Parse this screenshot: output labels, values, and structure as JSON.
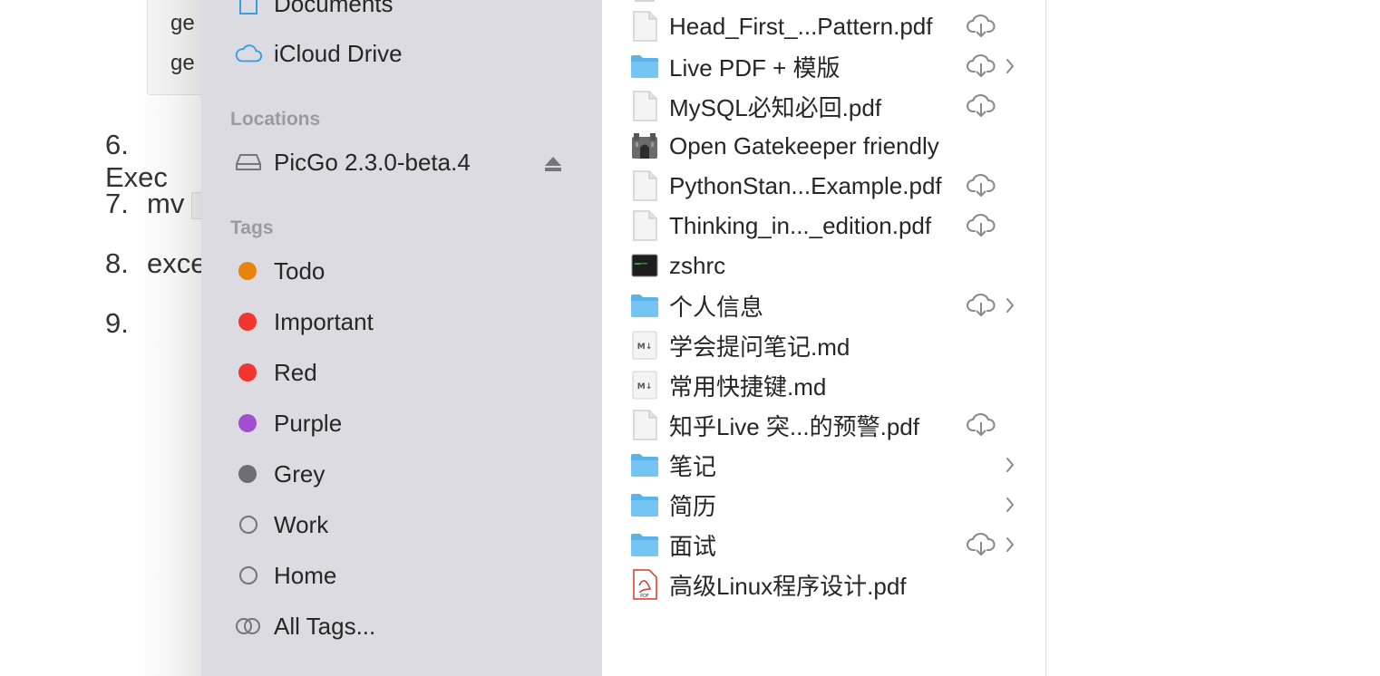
{
  "document": {
    "code_lines": [
      "ge",
      "ge"
    ],
    "list_items": [
      {
        "num": "6.",
        "text": "Exec"
      },
      {
        "num": "7.",
        "text": "mv"
      },
      {
        "num": "8.",
        "text": "exce"
      },
      {
        "num": "9.",
        "text": ""
      }
    ]
  },
  "sidebar": {
    "favorites": [
      {
        "label": "Documents",
        "icon": "document-icon"
      },
      {
        "label": "iCloud Drive",
        "icon": "icloud-icon"
      }
    ],
    "locations_header": "Locations",
    "locations": [
      {
        "label": "PicGo 2.3.0-beta.4",
        "icon": "drive-icon",
        "ejectable": true
      }
    ],
    "tags_header": "Tags",
    "tags": [
      {
        "label": "Todo",
        "color": "#e8830c",
        "style": "dot"
      },
      {
        "label": "Important",
        "color": "#f0362f",
        "style": "dot"
      },
      {
        "label": "Red",
        "color": "#f0362f",
        "style": "dot"
      },
      {
        "label": "Purple",
        "color": "#a14ed1",
        "style": "dot"
      },
      {
        "label": "Grey",
        "color": "#6e6d73",
        "style": "dot"
      },
      {
        "label": "Work",
        "color": "#76757b",
        "style": "ring"
      },
      {
        "label": "Home",
        "color": "#76757b",
        "style": "ring"
      },
      {
        "label": "All Tags...",
        "color": "#76757b",
        "style": "all"
      }
    ]
  },
  "files": [
    {
      "name": "Head_First_...Pattern.pdf",
      "icon": "file-icon",
      "cloud": true,
      "chevron": false
    },
    {
      "name": "Live PDF + 模版",
      "icon": "folder-icon",
      "cloud": true,
      "chevron": true
    },
    {
      "name": "MySQL必知必回.pdf",
      "icon": "file-icon",
      "cloud": true,
      "chevron": false
    },
    {
      "name": "Open Gatekeeper friendly",
      "icon": "app-icon",
      "cloud": false,
      "chevron": false
    },
    {
      "name": "PythonStan...Example.pdf",
      "icon": "file-icon",
      "cloud": true,
      "chevron": false
    },
    {
      "name": "Thinking_in..._edition.pdf",
      "icon": "file-icon",
      "cloud": true,
      "chevron": false
    },
    {
      "name": "zshrc",
      "icon": "terminal-icon",
      "cloud": false,
      "chevron": false
    },
    {
      "name": "个人信息",
      "icon": "folder-icon",
      "cloud": true,
      "chevron": true
    },
    {
      "name": "学会提问笔记.md",
      "icon": "markdown-icon",
      "cloud": false,
      "chevron": false
    },
    {
      "name": "常用快捷键.md",
      "icon": "markdown-icon",
      "cloud": false,
      "chevron": false
    },
    {
      "name": "知乎Live 突...的预警.pdf",
      "icon": "file-icon",
      "cloud": true,
      "chevron": false
    },
    {
      "name": "笔记",
      "icon": "folder-icon",
      "cloud": false,
      "chevron": true
    },
    {
      "name": "简历",
      "icon": "folder-icon",
      "cloud": false,
      "chevron": true
    },
    {
      "name": "面试",
      "icon": "folder-icon",
      "cloud": true,
      "chevron": true
    },
    {
      "name": "高级Linux程序设计.pdf",
      "icon": "pdf-icon",
      "cloud": false,
      "chevron": false
    }
  ],
  "colors": {
    "sidebar_bg": "#dcdbe1",
    "folder_blue": "#5ab4ec",
    "icloud_blue": "#3a9ee6"
  },
  "icons": {
    "eject": "eject-icon",
    "cloud": "cloud-download-icon",
    "chevron": "chevron-right-icon"
  }
}
